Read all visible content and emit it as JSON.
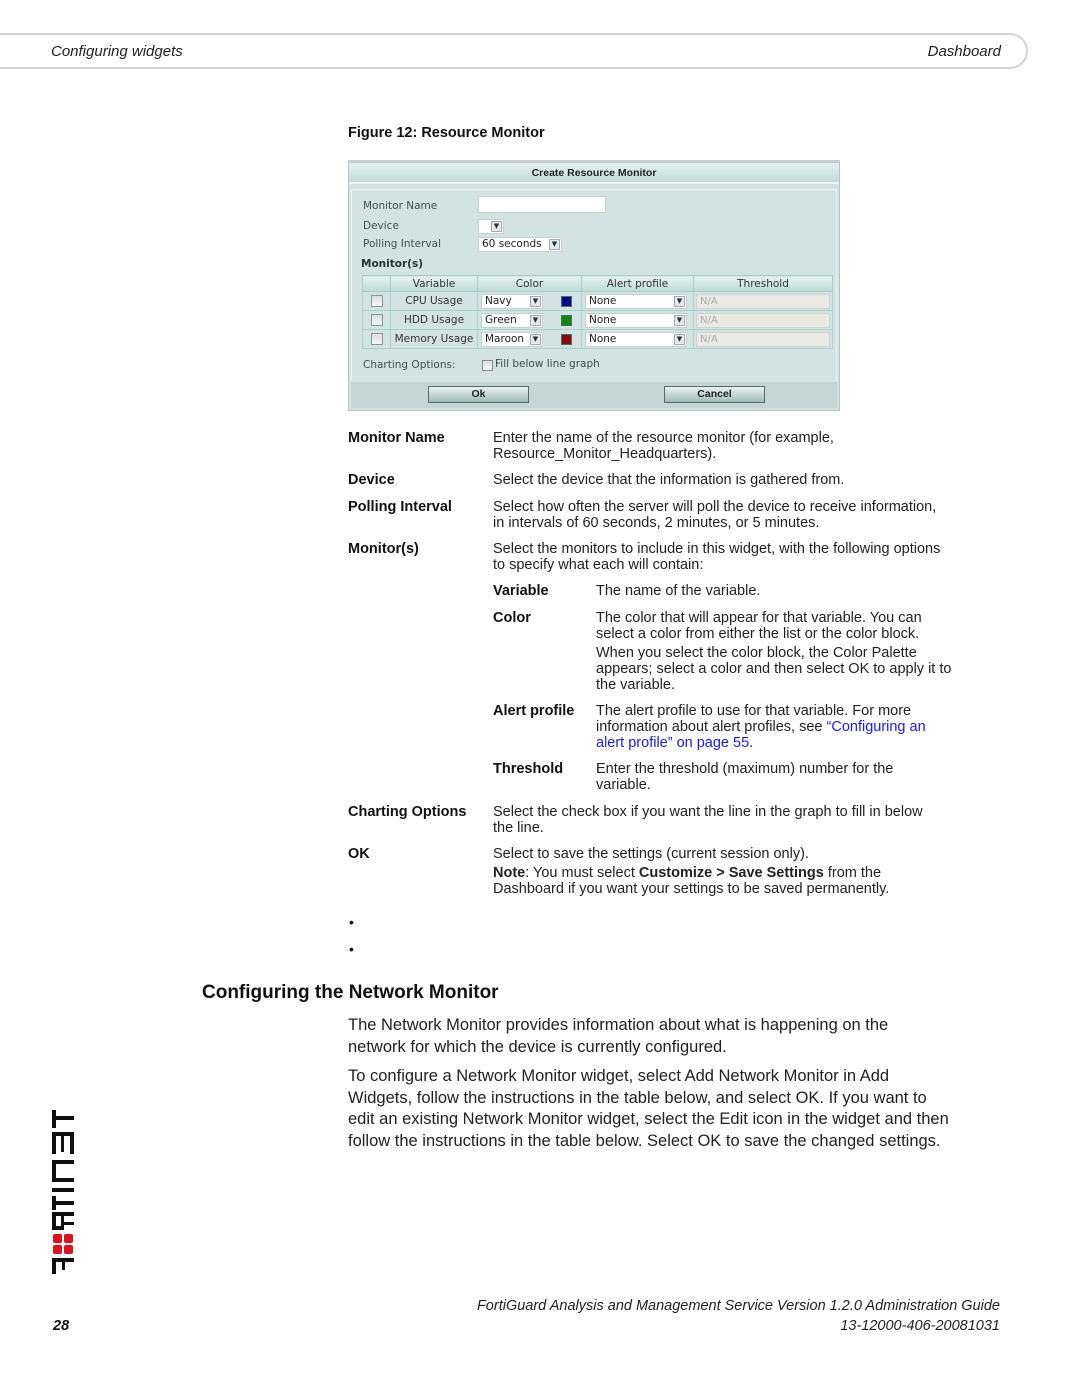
{
  "header": {
    "section": "Configuring widgets",
    "chapter": "Dashboard"
  },
  "figure": {
    "caption": "Figure 12: Resource Monitor",
    "dialog": {
      "title": "Create Resource Monitor",
      "monitor_name_label": "Monitor Name",
      "monitor_name_value": "",
      "device_label": "Device",
      "device_value": "",
      "polling_label": "Polling Interval",
      "polling_value": "60 seconds",
      "monitors_label": "Monitor(s)",
      "columns": [
        "",
        "Variable",
        "Color",
        "Alert profile",
        "Threshold"
      ],
      "rows": [
        {
          "checked": false,
          "variable": "CPU Usage",
          "color": "Navy",
          "swatch": "#0b0b8a",
          "alert": "None",
          "threshold": "N/A"
        },
        {
          "checked": false,
          "variable": "HDD Usage",
          "color": "Green",
          "swatch": "#0a8a0a",
          "alert": "None",
          "threshold": "N/A"
        },
        {
          "checked": false,
          "variable": "Memory Usage",
          "color": "Maroon",
          "swatch": "#8a0a0a",
          "alert": "None",
          "threshold": "N/A"
        }
      ],
      "charting_label": "Charting Options:",
      "fill_label": "Fill below line graph",
      "fill_checked": false,
      "ok_label": "Ok",
      "cancel_label": "Cancel"
    }
  },
  "definitions": [
    {
      "term": "Monitor Name",
      "desc": [
        "Enter the name of the resource monitor (for example,",
        "Resource_Monitor_Headquarters)."
      ]
    },
    {
      "term": "Device",
      "desc": [
        "Select the device that the information is gathered from."
      ]
    },
    {
      "term": "Polling Interval",
      "desc": [
        "Select how often the server will poll the device to receive information,",
        "in intervals of 60 seconds, 2 minutes, or 5 minutes."
      ]
    },
    {
      "term": "Monitor(s)",
      "desc": [
        "Select the monitors to include in this widget, with the following options",
        "to specify what each will contain:"
      ]
    }
  ],
  "sub_definitions": [
    {
      "term": "Variable",
      "desc": [
        "The name of the variable."
      ]
    },
    {
      "term": "Color",
      "desc": [
        "The color that will appear for that variable. You can",
        "select a color from either the list or the color block."
      ],
      "desc2": [
        "When you select the color block, the Color Palette",
        "appears; select a color and then select OK to apply it to",
        "the variable."
      ]
    },
    {
      "term": "Alert profile",
      "desc_pre": "The alert profile to use for that variable. For more",
      "desc_pre2": "information about alert profiles, see ",
      "link1": "“Configuring an",
      "link2": "alert profile” on page 55",
      "desc_post": "."
    },
    {
      "term": "Threshold",
      "desc": [
        "Enter the threshold (maximum) number for the",
        "variable."
      ]
    }
  ],
  "definitions2": [
    {
      "term": "Charting Options",
      "desc": [
        "Select the check box if you want the line in the graph to fill in below",
        "the line."
      ]
    },
    {
      "term": "OK",
      "desc": [
        "Select to save the settings (current session only)."
      ],
      "note_label": "Note",
      "note_pre": ": You must select ",
      "note_bold": "Customize > Save Settings",
      "note_post": " from the",
      "note_line2": "Dashboard if you want your settings to be saved permanently."
    }
  ],
  "bullets": [
    "•",
    "•"
  ],
  "section": {
    "heading": "Configuring the Network Monitor",
    "para1": [
      "The Network Monitor provides information about what is happening on the",
      "network for which the device is currently configured."
    ],
    "para2": [
      "To configure a Network Monitor widget, select Add Network Monitor in Add",
      "Widgets, follow the instructions in the table below, and select OK. If you want to",
      "edit an existing Network Monitor widget, select the Edit icon in the widget and then",
      "follow the instructions in the table below. Select OK to save the changed settings."
    ]
  },
  "logo": {
    "name": "FORTINET",
    "accent": "#e0101c"
  },
  "footer": {
    "title": "FortiGuard Analysis and Management Service Version 1.2.0 Administration Guide",
    "doc_number": "13-12000-406-20081031",
    "page": "28"
  }
}
